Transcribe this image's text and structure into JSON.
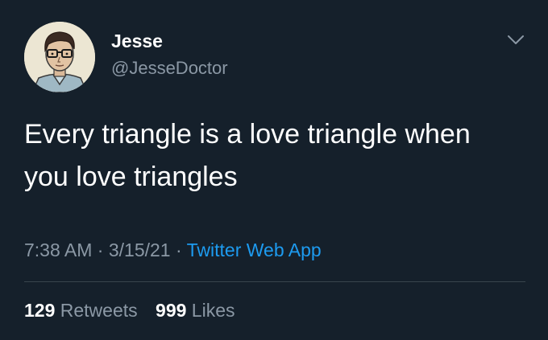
{
  "user": {
    "display_name": "Jesse",
    "handle": "@JesseDoctor"
  },
  "tweet": {
    "text_line1": "Every triangle is a love triangle when",
    "text_line2": "you love triangles",
    "time": "7:38 AM",
    "date": "3/15/21",
    "separator": "·",
    "source": "Twitter Web App"
  },
  "stats": {
    "retweets_count": "129",
    "retweets_label": "Retweets",
    "likes_count": "999",
    "likes_label": "Likes"
  },
  "icons": {
    "menu": "chevron-down-icon",
    "avatar": "avatar"
  },
  "colors": {
    "background": "#15202b",
    "primary_text": "#ffffff",
    "secondary_text": "#8b98a5",
    "link": "#1d9bf0",
    "divider": "#38444d"
  }
}
